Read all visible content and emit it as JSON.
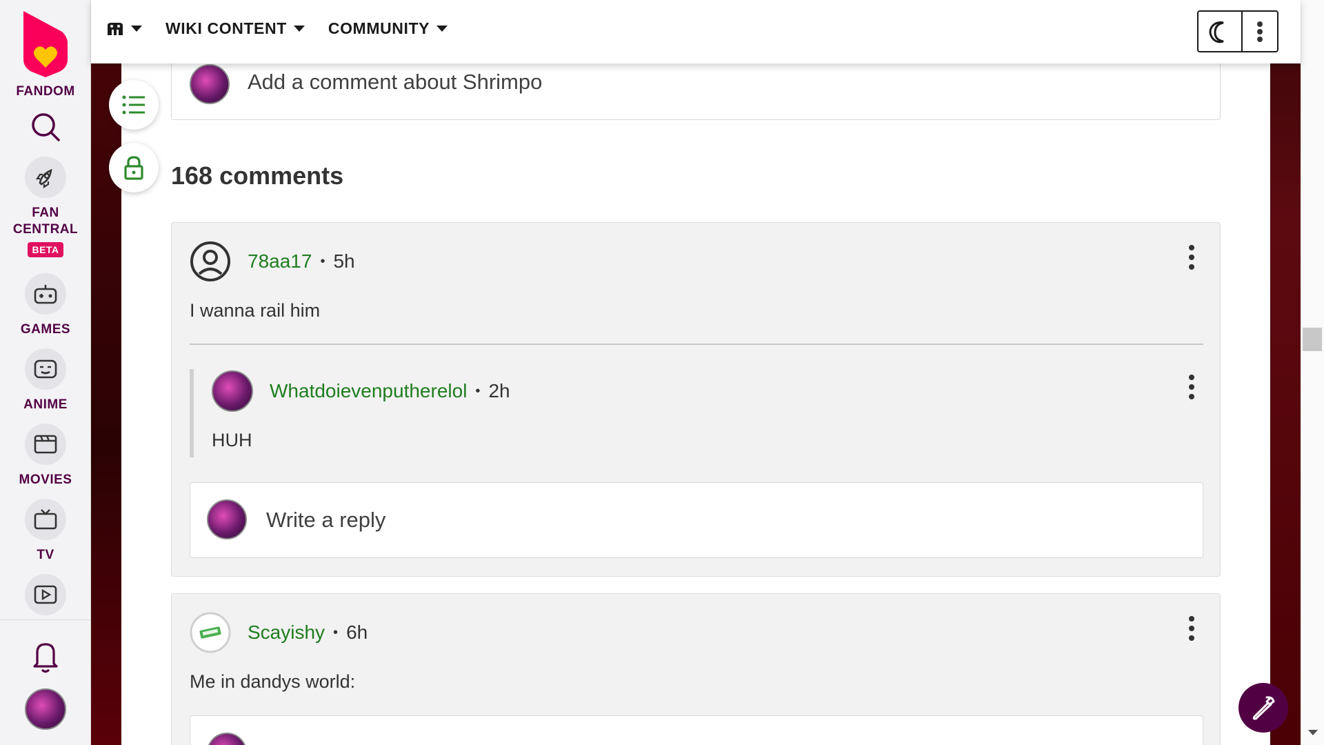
{
  "global_nav": {
    "brand": "FANDOM",
    "items": [
      {
        "label": "FAN CENTRAL",
        "badge": "BETA",
        "icon": "rocket-icon"
      },
      {
        "label": "GAMES",
        "icon": "gamepad-icon"
      },
      {
        "label": "ANIME",
        "icon": "anime-face-icon"
      },
      {
        "label": "MOVIES",
        "icon": "clapperboard-icon"
      },
      {
        "label": "TV",
        "icon": "tv-icon"
      },
      {
        "label": "",
        "icon": "video-play-icon"
      }
    ]
  },
  "topbar": {
    "menu_wiki_content": "WIKI CONTENT",
    "menu_community": "COMMUNITY"
  },
  "comments": {
    "add_placeholder": "Add a comment about Shrimpo",
    "count_label": "168 comments",
    "list": [
      {
        "user": "78aa17",
        "time": "5h",
        "body": "I wanna rail him",
        "replies": [
          {
            "user": "Whatdoievenputherelol",
            "time": "2h",
            "body": "HUH"
          }
        ],
        "reply_placeholder": "Write a reply"
      },
      {
        "user": "Scayishy",
        "time": "6h",
        "body": "Me in dandys world:"
      }
    ]
  },
  "colors": {
    "brand": "#520044",
    "username": "#1e7d1e",
    "accent_pink": "#e0115f"
  }
}
